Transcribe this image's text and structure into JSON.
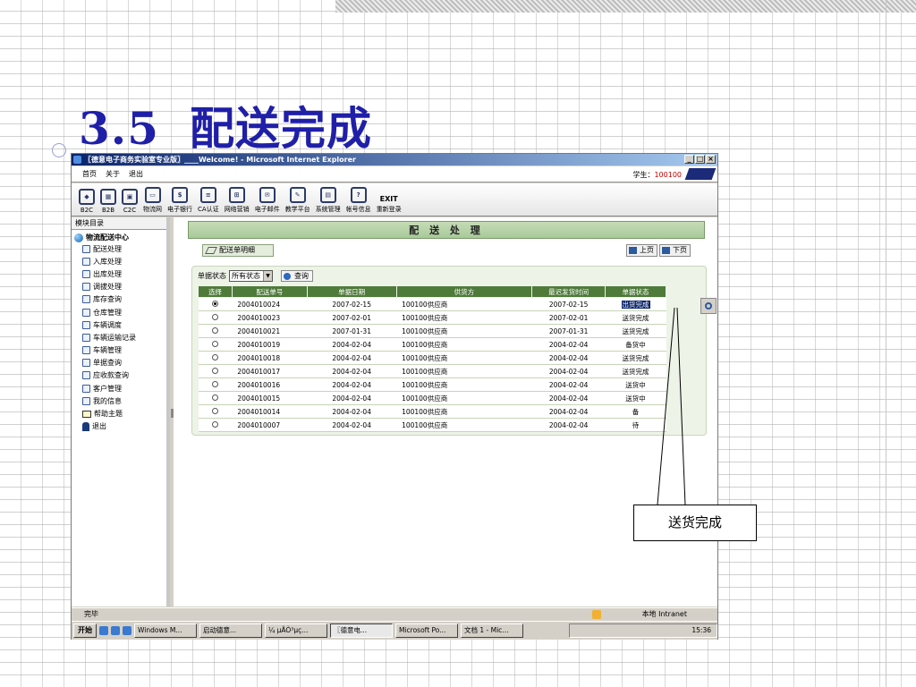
{
  "slide": {
    "number": "3.5",
    "title": "配送完成"
  },
  "window": {
    "title": "〖德意电子商务实验室专业版〗____Welcome! - Microsoft Internet Explorer",
    "buttons": [
      "_",
      "□",
      "×"
    ]
  },
  "menu": {
    "items": [
      "首页",
      "关于",
      "退出"
    ],
    "student_label": "学生：",
    "student_id": "100100"
  },
  "toolbar": {
    "items": [
      {
        "label": "B2C",
        "icon": "b2c-icon"
      },
      {
        "label": "B2B",
        "icon": "b2b-icon"
      },
      {
        "label": "C2C",
        "icon": "c2c-icon"
      },
      {
        "label": "物流网",
        "icon": "truck-icon"
      },
      {
        "label": "电子银行",
        "icon": "bank-icon"
      },
      {
        "label": "CA认证",
        "icon": "certificate-icon"
      },
      {
        "label": "网络营销",
        "icon": "network-icon"
      },
      {
        "label": "电子邮件",
        "icon": "mail-icon"
      },
      {
        "label": "教学平台",
        "icon": "teaching-icon"
      },
      {
        "label": "系统管理",
        "icon": "system-icon"
      },
      {
        "label": "帐号信息",
        "icon": "help-icon"
      },
      {
        "label": "重新登录",
        "icon": "exit-icon"
      }
    ],
    "exit_text": "EXIT"
  },
  "sidebar": {
    "header": "模块目录",
    "root": "物流配送中心",
    "items": [
      {
        "label": "配送处理",
        "icon": "page-icon"
      },
      {
        "label": "入库处理",
        "icon": "page-icon"
      },
      {
        "label": "出库处理",
        "icon": "page-icon"
      },
      {
        "label": "调拔处理",
        "icon": "page-icon"
      },
      {
        "label": "库存查询",
        "icon": "page-icon"
      },
      {
        "label": "仓库管理",
        "icon": "page-icon"
      },
      {
        "label": "车辆调度",
        "icon": "page-icon"
      },
      {
        "label": "车辆运输记录",
        "icon": "page-icon"
      },
      {
        "label": "车辆管理",
        "icon": "page-icon"
      },
      {
        "label": "单据查询",
        "icon": "page-icon"
      },
      {
        "label": "应收款查询",
        "icon": "page-icon"
      },
      {
        "label": "客户管理",
        "icon": "page-icon"
      },
      {
        "label": "我的信息",
        "icon": "page-icon"
      },
      {
        "label": "帮助主题",
        "icon": "help-icon"
      },
      {
        "label": "退出",
        "icon": "exit-person-icon"
      }
    ]
  },
  "main": {
    "banner": "配 送 处 理",
    "detail_button": "配送单明细",
    "prev_page": "上页",
    "next_page": "下页",
    "filter_label": "单据状态",
    "filter_value": "所有状态",
    "query_button": "查询",
    "columns": [
      "选择",
      "配送单号",
      "单据日期",
      "供货方",
      "最迟发货时间",
      "单据状态"
    ],
    "rows": [
      {
        "selected": true,
        "no": "2004010024",
        "date": "2007-02-15",
        "supplier": "100100供应商",
        "deadline": "2007-02-15",
        "status": "出货完成"
      },
      {
        "selected": false,
        "no": "2004010023",
        "date": "2007-02-01",
        "supplier": "100100供应商",
        "deadline": "2007-02-01",
        "status": "送货完成"
      },
      {
        "selected": false,
        "no": "2004010021",
        "date": "2007-01-31",
        "supplier": "100100供应商",
        "deadline": "2007-01-31",
        "status": "送货完成"
      },
      {
        "selected": false,
        "no": "2004010019",
        "date": "2004-02-04",
        "supplier": "100100供应商",
        "deadline": "2004-02-04",
        "status": "备货中"
      },
      {
        "selected": false,
        "no": "2004010018",
        "date": "2004-02-04",
        "supplier": "100100供应商",
        "deadline": "2004-02-04",
        "status": "送货完成"
      },
      {
        "selected": false,
        "no": "2004010017",
        "date": "2004-02-04",
        "supplier": "100100供应商",
        "deadline": "2004-02-04",
        "status": "送货完成"
      },
      {
        "selected": false,
        "no": "2004010016",
        "date": "2004-02-04",
        "supplier": "100100供应商",
        "deadline": "2004-02-04",
        "status": "送货中"
      },
      {
        "selected": false,
        "no": "2004010015",
        "date": "2004-02-04",
        "supplier": "100100供应商",
        "deadline": "2004-02-04",
        "status": "送货中"
      },
      {
        "selected": false,
        "no": "2004010014",
        "date": "2004-02-04",
        "supplier": "100100供应商",
        "deadline": "2004-02-04",
        "status": "备"
      },
      {
        "selected": false,
        "no": "2004010007",
        "date": "2004-02-04",
        "supplier": "100100供应商",
        "deadline": "2004-02-04",
        "status": "待"
      }
    ]
  },
  "status": {
    "text": "完毕",
    "zone": "本地 Intranet"
  },
  "taskbar": {
    "start": "开始",
    "tasks": [
      "Windows M...",
      "启动德意...",
      "¼ µÄÒ³µç...",
      "〖德意电...",
      "Microsoft Po...",
      "文档 1 - Mic..."
    ],
    "active_index": 3,
    "clock": "15:36"
  },
  "callout": {
    "text": "送货完成"
  }
}
